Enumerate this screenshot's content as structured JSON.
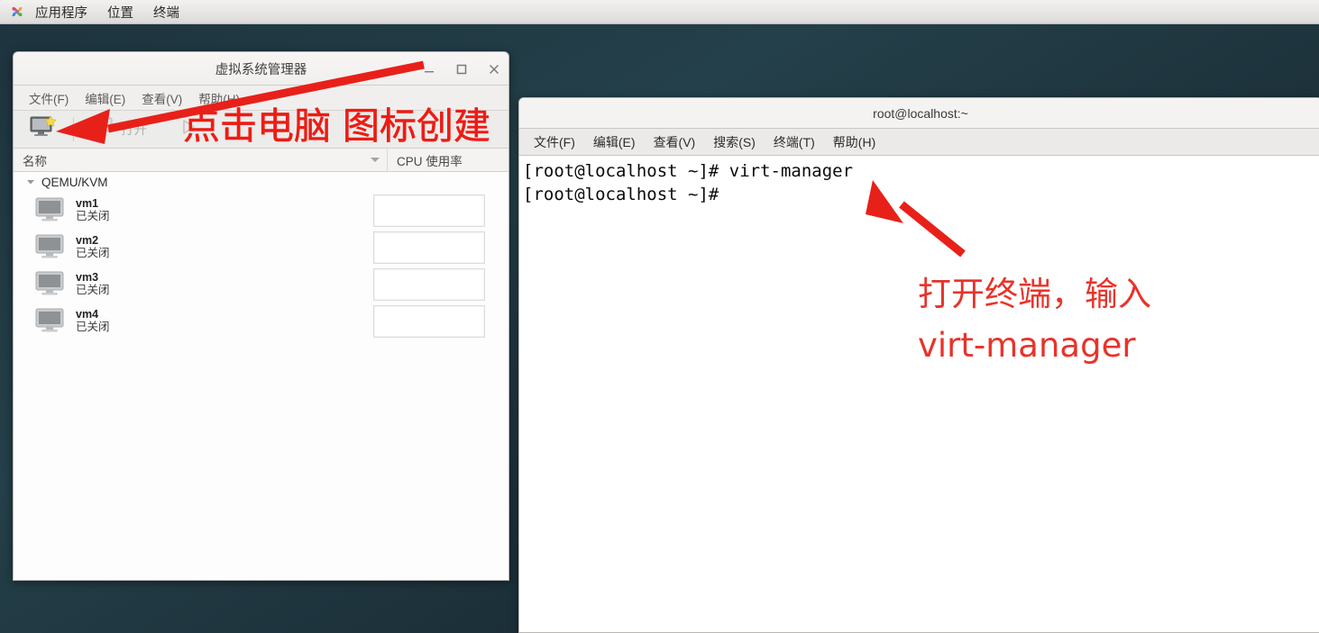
{
  "desktop": {
    "panel": {
      "logo_icon": "pinwheel-icon",
      "items": [
        {
          "label": "应用程序"
        },
        {
          "label": "位置"
        },
        {
          "label": "终端"
        }
      ]
    },
    "background_color": "#1d333d"
  },
  "vmm_window": {
    "title": "虚拟系统管理器",
    "window_buttons": {
      "minimize": "—",
      "maximize": "□",
      "close": "✕"
    },
    "menus": [
      {
        "label": "文件(F)"
      },
      {
        "label": "编辑(E)"
      },
      {
        "label": "查看(V)"
      },
      {
        "label": "帮助(H)"
      }
    ],
    "toolbar": {
      "new_vm_icon": "new-virtual-machine-icon",
      "open_icon": "open-monitor-icon",
      "open_label": "打开",
      "run_icon": "play-triangle-icon"
    },
    "columns": {
      "name": "名称",
      "cpu": "CPU 使用率",
      "sort_icon": "caret-down-icon"
    },
    "connection": {
      "label": "QEMU/KVM",
      "expander_icon": "triangle-down-icon"
    },
    "vms": [
      {
        "icon": "monitor-icon",
        "name": "vm1",
        "state": "已关闭",
        "cpu_graph": ""
      },
      {
        "icon": "monitor-icon",
        "name": "vm2",
        "state": "已关闭",
        "cpu_graph": ""
      },
      {
        "icon": "monitor-icon",
        "name": "vm3",
        "state": "已关闭",
        "cpu_graph": ""
      },
      {
        "icon": "monitor-icon",
        "name": "vm4",
        "state": "已关闭",
        "cpu_graph": ""
      }
    ]
  },
  "terminal_window": {
    "title": "root@localhost:~",
    "menus": [
      {
        "label": "文件(F)"
      },
      {
        "label": "编辑(E)"
      },
      {
        "label": "查看(V)"
      },
      {
        "label": "搜索(S)"
      },
      {
        "label": "终端(T)"
      },
      {
        "label": "帮助(H)"
      }
    ],
    "lines": [
      "[root@localhost ~]# virt-manager",
      "[root@localhost ~]# "
    ],
    "content": "[root@localhost ~]# virt-manager\n[root@localhost ~]# "
  },
  "annotations": {
    "color": "#ee1b14",
    "text_1": "点击电脑 图标创建",
    "text_2": "打开终端，输入\nvirt-manager",
    "arrow_1": "arrow-pointing-left-to-new-vm-icon",
    "arrow_2": "arrow-pointing-upleft-to-command"
  }
}
